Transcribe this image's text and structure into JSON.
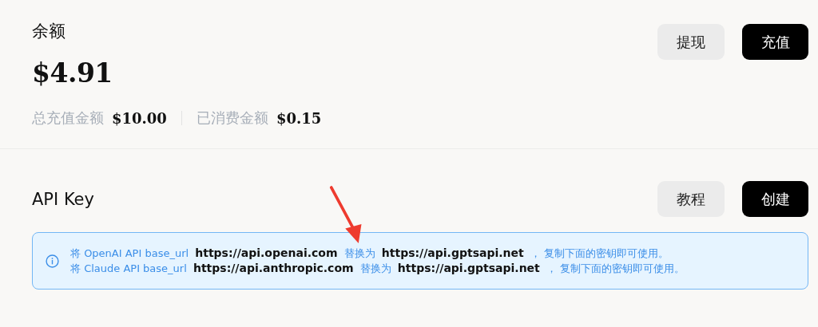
{
  "balance": {
    "title": "余额",
    "amount": "$4.91",
    "stats": [
      {
        "label": "总充值金额",
        "value": "$10.00"
      },
      {
        "label": "已消费金额",
        "value": "$0.15"
      }
    ],
    "buttons": [
      {
        "label": "提现",
        "kind": "secondary"
      },
      {
        "label": "充值",
        "kind": "primary"
      }
    ]
  },
  "api_key": {
    "title": "API Key",
    "buttons": [
      {
        "label": "教程",
        "kind": "secondary"
      },
      {
        "label": "创建",
        "kind": "primary"
      }
    ],
    "info_lines": [
      "将 OpenAI API base_url **https://api.openai.com** 替换为 **https://api.gptsapi.net** ， 复制下面的密钥即可使用。",
      "将 Claude API base_url **https://api.anthropic.com** 替换为 **https://api.gptsapi.net** ， 复制下面的密钥即可使用。"
    ]
  }
}
